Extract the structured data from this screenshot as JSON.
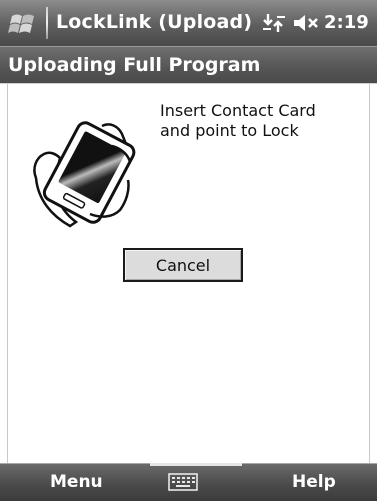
{
  "titlebar": {
    "title": "LockLink (Upload)",
    "time": "2:19",
    "icons": [
      "windows-flag-icon",
      "connectivity-icon",
      "speaker-muted-icon"
    ]
  },
  "header": {
    "title": "Uploading Full Program"
  },
  "instructions": {
    "line1": "Insert Contact Card",
    "line2": "and point to Lock"
  },
  "illustration": {
    "icon": "hand-holding-card-icon"
  },
  "buttons": {
    "cancel": "Cancel"
  },
  "softkeys": {
    "left": "Menu",
    "right": "Help",
    "center_icon": "keyboard-icon"
  }
}
